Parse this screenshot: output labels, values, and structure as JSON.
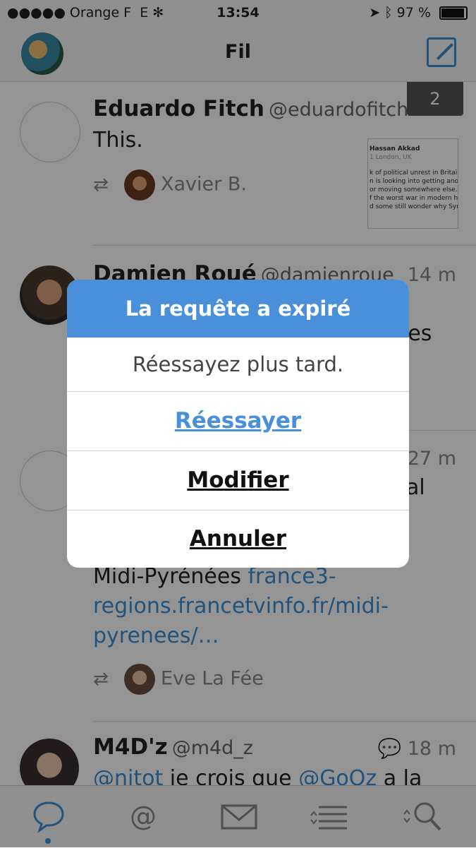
{
  "status_bar": {
    "carrier": "●●●●● Orange F",
    "network": "E",
    "time": "13:54",
    "battery": "97 %"
  },
  "nav": {
    "title": "Fil"
  },
  "badge": "2",
  "thumbnail": {
    "lines": [
      "Hassan Akkad",
      "1 London, UK",
      "k of political unrest in Britain,",
      "n is looking into getting anoth",
      "or moving somewhere else.",
      "f the worst war in modern his",
      "d some still wonder why Syria"
    ]
  },
  "tweets": [
    {
      "name": "Eduardo Fitch",
      "handle": "@eduardofitch",
      "time": "",
      "text": "This.",
      "retweeted_by": "Xavier B."
    },
    {
      "name": "Damien Roué",
      "handle": "@damienroue",
      "time": "14 m",
      "text": "…les",
      "retweeted_by": ""
    },
    {
      "name": "",
      "handle": "",
      "time": "27 m",
      "text_plain": "Midi-Pyrénées ",
      "text_link": "france3-regions.francetvinfo.fr/midi-pyrenees/…",
      "fragment": "al",
      "retweeted_by": "Eve La Fée"
    },
    {
      "name": "M4D'z",
      "handle": "@m4d_z",
      "time": "18 m",
      "text_link1": "@nitot",
      "text_mid": " je crois que ",
      "text_link2": "@GoOz",
      "text_end": " a la"
    }
  ],
  "tabs": [
    "mentions-tab",
    "at-tab",
    "messages-tab",
    "lists-tab",
    "search-tab"
  ],
  "alert": {
    "title": "La requête a expiré",
    "message": "Réessayez plus tard.",
    "buttons": {
      "retry": "Réessayer",
      "edit": "Modifier",
      "cancel": "Annuler"
    }
  },
  "colors": {
    "accent": "#4a8fd9",
    "link": "#3a8fd8"
  }
}
